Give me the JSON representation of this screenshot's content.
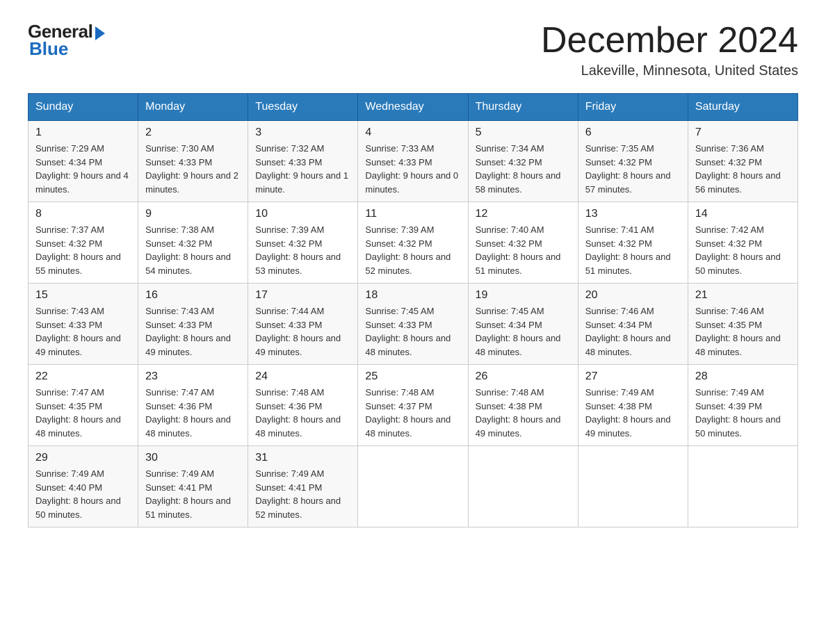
{
  "logo": {
    "general": "General",
    "blue": "Blue"
  },
  "header": {
    "month": "December 2024",
    "location": "Lakeville, Minnesota, United States"
  },
  "weekdays": [
    "Sunday",
    "Monday",
    "Tuesday",
    "Wednesday",
    "Thursday",
    "Friday",
    "Saturday"
  ],
  "weeks": [
    [
      {
        "day": "1",
        "sunrise": "7:29 AM",
        "sunset": "4:34 PM",
        "daylight": "9 hours and 4 minutes."
      },
      {
        "day": "2",
        "sunrise": "7:30 AM",
        "sunset": "4:33 PM",
        "daylight": "9 hours and 2 minutes."
      },
      {
        "day": "3",
        "sunrise": "7:32 AM",
        "sunset": "4:33 PM",
        "daylight": "9 hours and 1 minute."
      },
      {
        "day": "4",
        "sunrise": "7:33 AM",
        "sunset": "4:33 PM",
        "daylight": "9 hours and 0 minutes."
      },
      {
        "day": "5",
        "sunrise": "7:34 AM",
        "sunset": "4:32 PM",
        "daylight": "8 hours and 58 minutes."
      },
      {
        "day": "6",
        "sunrise": "7:35 AM",
        "sunset": "4:32 PM",
        "daylight": "8 hours and 57 minutes."
      },
      {
        "day": "7",
        "sunrise": "7:36 AM",
        "sunset": "4:32 PM",
        "daylight": "8 hours and 56 minutes."
      }
    ],
    [
      {
        "day": "8",
        "sunrise": "7:37 AM",
        "sunset": "4:32 PM",
        "daylight": "8 hours and 55 minutes."
      },
      {
        "day": "9",
        "sunrise": "7:38 AM",
        "sunset": "4:32 PM",
        "daylight": "8 hours and 54 minutes."
      },
      {
        "day": "10",
        "sunrise": "7:39 AM",
        "sunset": "4:32 PM",
        "daylight": "8 hours and 53 minutes."
      },
      {
        "day": "11",
        "sunrise": "7:39 AM",
        "sunset": "4:32 PM",
        "daylight": "8 hours and 52 minutes."
      },
      {
        "day": "12",
        "sunrise": "7:40 AM",
        "sunset": "4:32 PM",
        "daylight": "8 hours and 51 minutes."
      },
      {
        "day": "13",
        "sunrise": "7:41 AM",
        "sunset": "4:32 PM",
        "daylight": "8 hours and 51 minutes."
      },
      {
        "day": "14",
        "sunrise": "7:42 AM",
        "sunset": "4:32 PM",
        "daylight": "8 hours and 50 minutes."
      }
    ],
    [
      {
        "day": "15",
        "sunrise": "7:43 AM",
        "sunset": "4:33 PM",
        "daylight": "8 hours and 49 minutes."
      },
      {
        "day": "16",
        "sunrise": "7:43 AM",
        "sunset": "4:33 PM",
        "daylight": "8 hours and 49 minutes."
      },
      {
        "day": "17",
        "sunrise": "7:44 AM",
        "sunset": "4:33 PM",
        "daylight": "8 hours and 49 minutes."
      },
      {
        "day": "18",
        "sunrise": "7:45 AM",
        "sunset": "4:33 PM",
        "daylight": "8 hours and 48 minutes."
      },
      {
        "day": "19",
        "sunrise": "7:45 AM",
        "sunset": "4:34 PM",
        "daylight": "8 hours and 48 minutes."
      },
      {
        "day": "20",
        "sunrise": "7:46 AM",
        "sunset": "4:34 PM",
        "daylight": "8 hours and 48 minutes."
      },
      {
        "day": "21",
        "sunrise": "7:46 AM",
        "sunset": "4:35 PM",
        "daylight": "8 hours and 48 minutes."
      }
    ],
    [
      {
        "day": "22",
        "sunrise": "7:47 AM",
        "sunset": "4:35 PM",
        "daylight": "8 hours and 48 minutes."
      },
      {
        "day": "23",
        "sunrise": "7:47 AM",
        "sunset": "4:36 PM",
        "daylight": "8 hours and 48 minutes."
      },
      {
        "day": "24",
        "sunrise": "7:48 AM",
        "sunset": "4:36 PM",
        "daylight": "8 hours and 48 minutes."
      },
      {
        "day": "25",
        "sunrise": "7:48 AM",
        "sunset": "4:37 PM",
        "daylight": "8 hours and 48 minutes."
      },
      {
        "day": "26",
        "sunrise": "7:48 AM",
        "sunset": "4:38 PM",
        "daylight": "8 hours and 49 minutes."
      },
      {
        "day": "27",
        "sunrise": "7:49 AM",
        "sunset": "4:38 PM",
        "daylight": "8 hours and 49 minutes."
      },
      {
        "day": "28",
        "sunrise": "7:49 AM",
        "sunset": "4:39 PM",
        "daylight": "8 hours and 50 minutes."
      }
    ],
    [
      {
        "day": "29",
        "sunrise": "7:49 AM",
        "sunset": "4:40 PM",
        "daylight": "8 hours and 50 minutes."
      },
      {
        "day": "30",
        "sunrise": "7:49 AM",
        "sunset": "4:41 PM",
        "daylight": "8 hours and 51 minutes."
      },
      {
        "day": "31",
        "sunrise": "7:49 AM",
        "sunset": "4:41 PM",
        "daylight": "8 hours and 52 minutes."
      },
      null,
      null,
      null,
      null
    ]
  ]
}
